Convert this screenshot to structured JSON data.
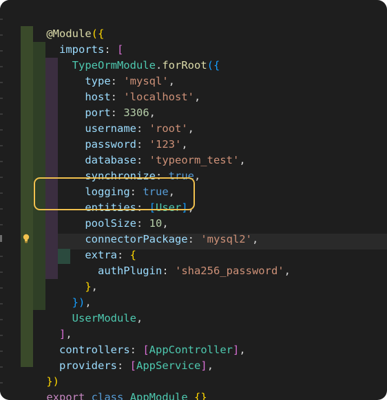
{
  "colors": {
    "highlight_box": "#f2c14e",
    "background": "#1e1e1e"
  },
  "icons": {
    "hint": "lightbulb-icon"
  },
  "code": {
    "l1": {
      "decorator": "@Module",
      "open": "({"
    },
    "l2": {
      "key": "imports",
      "colon": ":",
      "open": "["
    },
    "l3": {
      "cls": "TypeOrmModule",
      "dot": ".",
      "fn": "forRoot",
      "open": "({"
    },
    "l4": {
      "key": "type",
      "val": "'mysql'"
    },
    "l5": {
      "key": "host",
      "val": "'localhost'"
    },
    "l6": {
      "key": "port",
      "val": "3306"
    },
    "l7": {
      "key": "username",
      "val": "'root'"
    },
    "l8": {
      "key": "password",
      "val": "'123'"
    },
    "l9": {
      "key": "database",
      "val": "'typeorm_test'"
    },
    "l10": {
      "key": "synchronize",
      "val": "true"
    },
    "l11": {
      "key": "logging",
      "val": "true"
    },
    "l12": {
      "key": "entities",
      "open": "[",
      "val": "User",
      "close": "]"
    },
    "l13": {
      "key": "poolSize",
      "val": "10"
    },
    "l14": {
      "key": "connectorPackage",
      "val": "'mysql2'"
    },
    "l15": {
      "key": "extra",
      "open": "{"
    },
    "l16": {
      "key": "authPlugin",
      "val": "'sha256_password'"
    },
    "l17": {
      "close": "}"
    },
    "l18": {
      "close": "})"
    },
    "l19": {
      "cls": "UserModule"
    },
    "l20": {
      "close": "]"
    },
    "l21": {
      "key": "controllers",
      "open": "[",
      "val": "AppController",
      "close": "]"
    },
    "l22": {
      "key": "providers",
      "open": "[",
      "val": "AppService",
      "close": "]"
    },
    "l23": {
      "close": "})"
    },
    "l24": {
      "kw": "export",
      "kw2": "class",
      "cls": "AppModule",
      "braces": "{}"
    }
  }
}
